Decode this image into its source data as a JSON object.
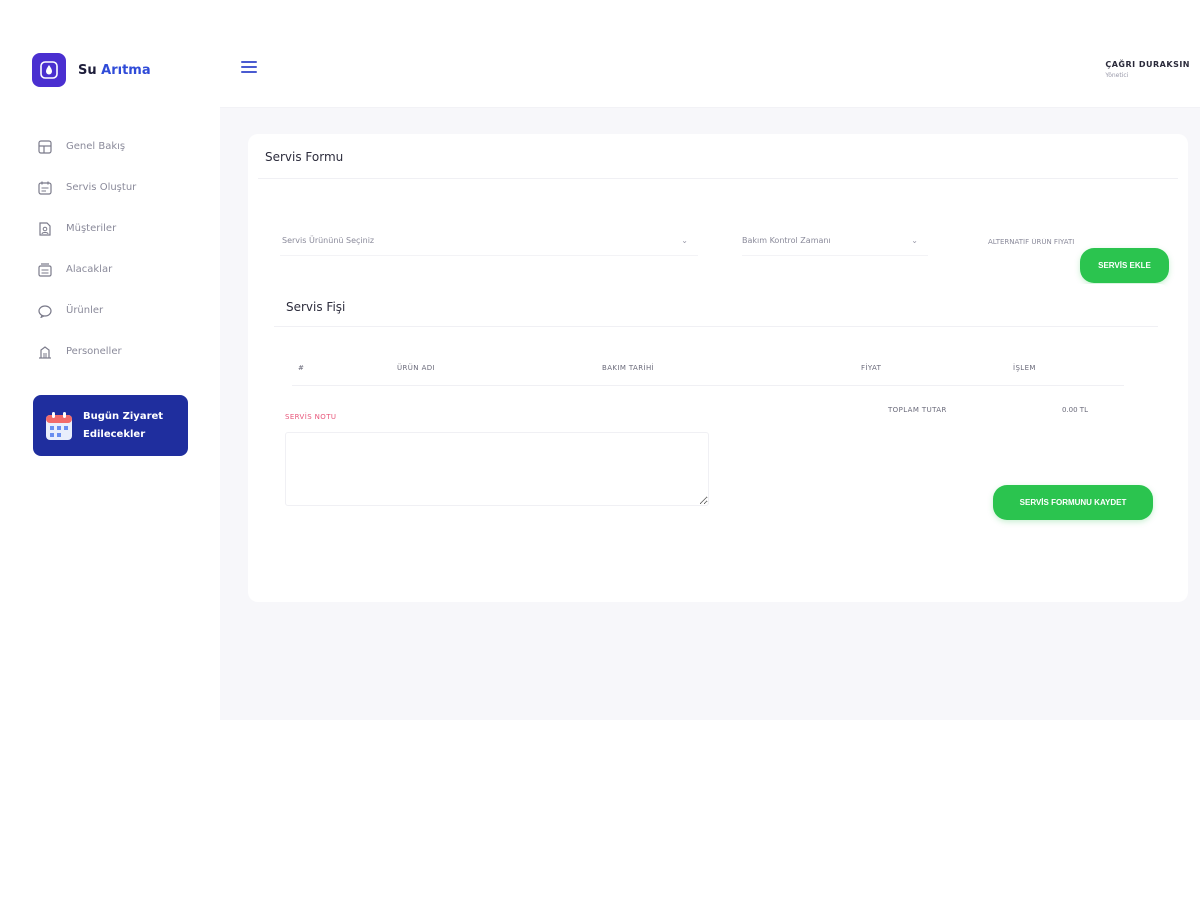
{
  "brand": {
    "name_part1": "Su",
    "name_part2": "Arıtma",
    "color": "#4a2fd0"
  },
  "sidebar": {
    "items": [
      {
        "label": "Genel Bakış",
        "icon": "dashboard-icon"
      },
      {
        "label": "Servis Oluştur",
        "icon": "calendar-icon"
      },
      {
        "label": "Müşteriler",
        "icon": "customers-icon"
      },
      {
        "label": "Alacaklar",
        "icon": "receivables-icon"
      },
      {
        "label": "Ürünler",
        "icon": "products-icon"
      },
      {
        "label": "Personeller",
        "icon": "staff-icon"
      }
    ],
    "visit_card": {
      "line1": "Bugün Ziyaret",
      "line2": "Edilecekler",
      "color": "#1f2e9e"
    }
  },
  "topbar": {
    "user_name": "ÇAĞRI DURAKSIN",
    "user_role": "Yönetici"
  },
  "form": {
    "title": "Servis Formu",
    "product_select": "Servis Ürününü Seçiniz",
    "maintenance_select": "Bakım Kontrol Zamanı",
    "alt_price_placeholder": "ALTERNATİF ÜRÜN FİYATI",
    "add_button": "SERVİS EKLE"
  },
  "receipt": {
    "title": "Servis Fişi",
    "columns": [
      "#",
      "ÜRÜN ADI",
      "BAKIM TARİHİ",
      "FİYAT",
      "İŞLEM"
    ],
    "note_label": "SERVİS NOTU",
    "total_label": "TOPLAM TUTAR",
    "total_value": "0.00 TL",
    "save_button": "SERVİS FORMUNU KAYDET"
  },
  "colors": {
    "accent_green": "#2bc44f",
    "note_pink": "#e8567a",
    "background": "#f7f7fa"
  }
}
